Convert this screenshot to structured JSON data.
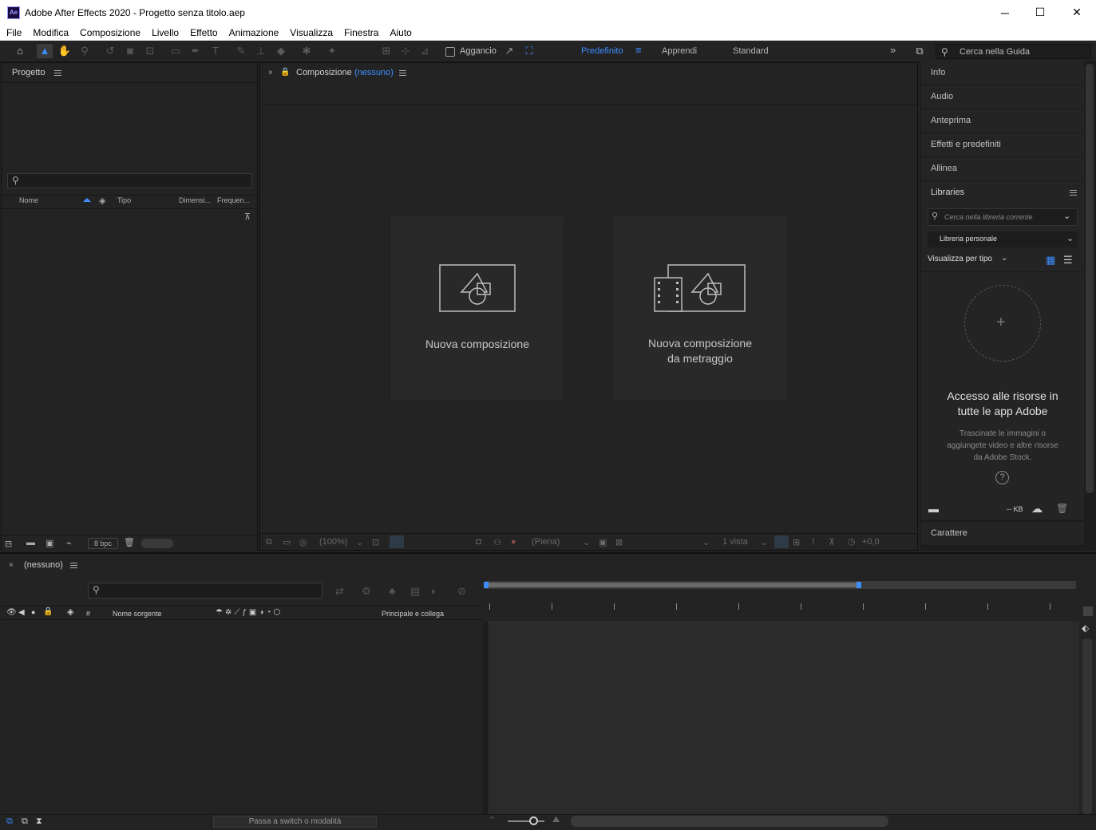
{
  "window": {
    "title": "Adobe After Effects 2020 - Progetto senza titolo.aep",
    "logo": "Ae",
    "minimize": "─",
    "maximize": "☐",
    "close": "✕"
  },
  "menu": [
    "File",
    "Modifica",
    "Composizione",
    "Livello",
    "Effetto",
    "Animazione",
    "Visualizza",
    "Finestra",
    "Aiuto"
  ],
  "toolbar": {
    "snap_label": "Aggancio",
    "workspaces": [
      "Predefinito",
      "Apprendi",
      "Standard"
    ],
    "active_workspace": "Predefinito",
    "search_placeholder": "Cerca nella Guida"
  },
  "project_panel": {
    "title": "Progetto",
    "columns": [
      "Nome",
      "Tipo",
      "Dimensi...",
      "Frequen..."
    ],
    "bpc": "8 bpc"
  },
  "comp_panel": {
    "title": "Composizione",
    "comp_name": "(nessuno)",
    "tiles": [
      {
        "line1": "Nuova composizione",
        "line2": ""
      },
      {
        "line1": "Nuova composizione",
        "line2": "da metraggio"
      }
    ],
    "zoom": "(100%)",
    "resolution": "(Piena)",
    "views": "1 vista",
    "exposure": "+0,0"
  },
  "right_panel": {
    "items": [
      "Info",
      "Audio",
      "Anteprima",
      "Effetti e predefiniti",
      "Allinea"
    ],
    "libraries": {
      "title": "Libraries",
      "search_placeholder": "Cerca nella libreria corrente",
      "library": "Libreria personale",
      "view_by": "Visualizza per tipo",
      "heading_line1": "Accesso alle risorse in",
      "heading_line2": "tutte le app Adobe",
      "desc_line1": "Trascinate le immagini o",
      "desc_line2": "aggiungete video e altre risorse",
      "desc_line3": "da Adobe Stock.",
      "size": "-- KB"
    },
    "carattere": "Carattere"
  },
  "timeline": {
    "title": "(nessuno)",
    "columns": {
      "source": "Nome sorgente",
      "parent": "Principale e collega",
      "hash": "#"
    },
    "switch_label": "Passa a switch o modalità"
  }
}
